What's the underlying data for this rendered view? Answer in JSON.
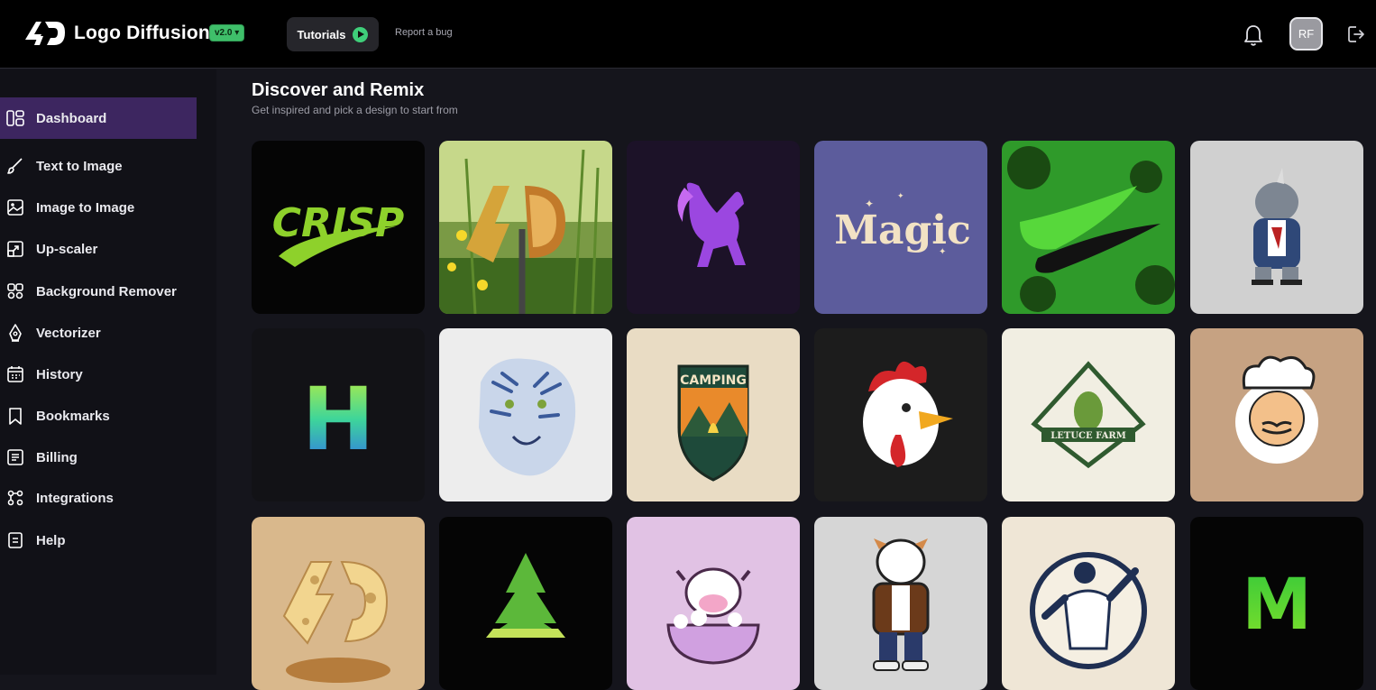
{
  "header": {
    "brand": "Logo Diffusion",
    "version": "v2.0 ▾",
    "tutorials_label": "Tutorials",
    "report_label": "Report a bug",
    "avatar_initials": "RF"
  },
  "sidebar": {
    "items": [
      {
        "label": "Dashboard",
        "icon": "dashboard-icon",
        "active": true
      },
      {
        "label": "Text to Image",
        "icon": "brush-icon"
      },
      {
        "label": "Image to Image",
        "icon": "image-icon"
      },
      {
        "label": "Up-scaler",
        "icon": "upscale-icon"
      },
      {
        "label": "Background Remover",
        "icon": "scissors-icon"
      },
      {
        "label": "Vectorizer",
        "icon": "pen-nib-icon"
      },
      {
        "label": "History",
        "icon": "calendar-icon"
      },
      {
        "label": "Bookmarks",
        "icon": "bookmark-icon"
      },
      {
        "label": "Billing",
        "icon": "receipt-icon"
      },
      {
        "label": "Integrations",
        "icon": "integrations-icon"
      },
      {
        "label": "Help",
        "icon": "help-doc-icon"
      }
    ]
  },
  "main": {
    "title": "Discover and Remix",
    "subtitle": "Get inspired and pick a design to start from"
  },
  "gallery": {
    "tiles": [
      {
        "text": "CRISP",
        "bg": "#050505"
      },
      {
        "text": "",
        "bg": "#7a9a45"
      },
      {
        "text": "",
        "bg": "#1c1228"
      },
      {
        "text": "Magic",
        "bg": "#5c5c9c"
      },
      {
        "text": "",
        "bg": "#2f9a2a"
      },
      {
        "text": "",
        "bg": "#d0d0d0"
      },
      {
        "text": "H",
        "bg": "#121216"
      },
      {
        "text": "",
        "bg": "#ededed"
      },
      {
        "text": "CAMPING",
        "bg": "#e9dcc4"
      },
      {
        "text": "",
        "bg": "#1c1c1c"
      },
      {
        "text": "LETUCE FARM",
        "bg": "#f1eee2"
      },
      {
        "text": "",
        "bg": "#c6a282"
      },
      {
        "text": "",
        "bg": "#d9b88c"
      },
      {
        "text": "",
        "bg": "#050505"
      },
      {
        "text": "",
        "bg": "#e1c2e4"
      },
      {
        "text": "",
        "bg": "#d6d6d6"
      },
      {
        "text": "",
        "bg": "#efe6d6"
      },
      {
        "text": "M",
        "bg": "#050505"
      }
    ]
  },
  "colors": {
    "accent_active": "#3d2660",
    "version_badge": "#3fbf6a",
    "play_button": "#3fcf7a"
  }
}
